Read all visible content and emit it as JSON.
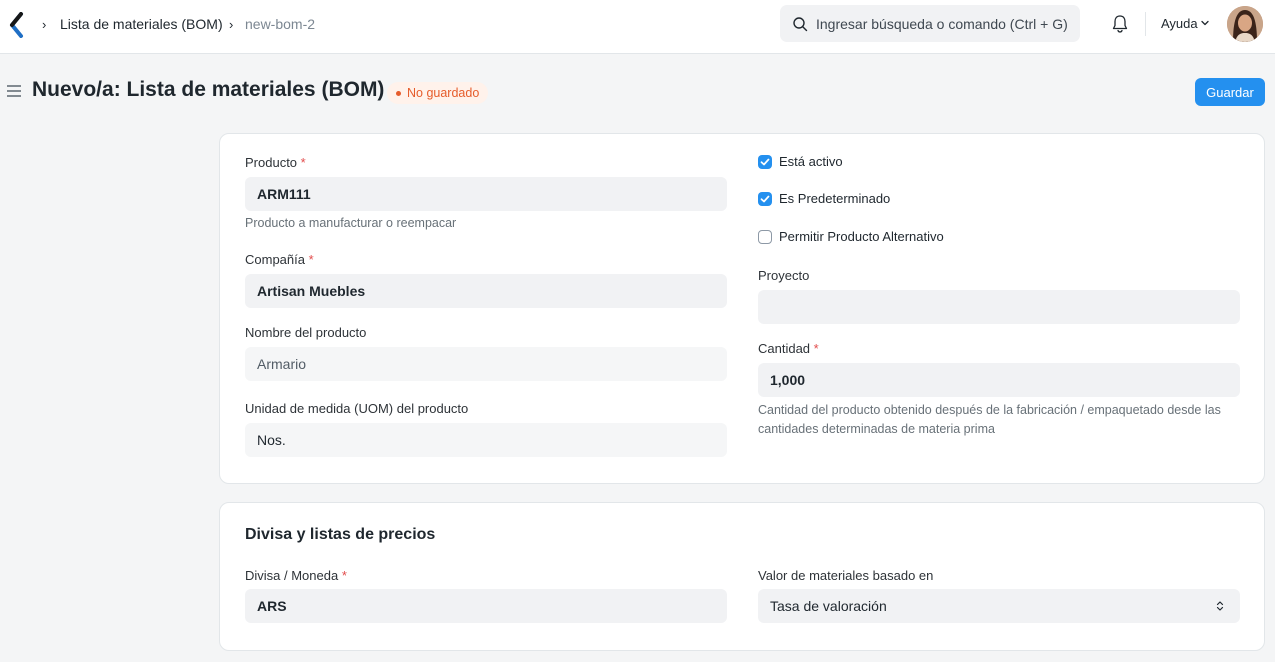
{
  "navbar": {
    "breadcrumbs": [
      "Lista de materiales (BOM)",
      "new-bom-2"
    ],
    "search_placeholder": "Ingresar búsqueda o comando (Ctrl + G)",
    "help_label": "Ayuda"
  },
  "header": {
    "title": "Nuevo/a: Lista de materiales (BOM)",
    "status": "No guardado",
    "save_label": "Guardar"
  },
  "form": {
    "producto": {
      "label": "Producto",
      "value": "ARM111",
      "help": "Producto a manufacturar o reempacar"
    },
    "compania": {
      "label": "Compañía",
      "value": "Artisan Muebles"
    },
    "nombre_producto": {
      "label": "Nombre del producto",
      "value": "Armario"
    },
    "uom": {
      "label": "Unidad de medida (UOM) del producto",
      "value": "Nos."
    },
    "esta_activo": {
      "label": "Está activo",
      "checked": true
    },
    "es_predeterminado": {
      "label": "Es Predeterminado",
      "checked": true
    },
    "permitir_alternativo": {
      "label": "Permitir Producto Alternativo",
      "checked": false
    },
    "proyecto": {
      "label": "Proyecto",
      "value": ""
    },
    "cantidad": {
      "label": "Cantidad",
      "value": "1,000",
      "help": "Cantidad del producto obtenido después de la fabricación / empaquetado desde las cantidades determinadas de materia prima"
    }
  },
  "section_currency": {
    "title": "Divisa y listas de precios",
    "divisa": {
      "label": "Divisa / Moneda",
      "value": "ARS"
    },
    "valor_materiales": {
      "label": "Valor de materiales basado en",
      "value": "Tasa de valoración"
    }
  },
  "colors": {
    "primary": "#2490ef",
    "unsaved": "#e65c2b",
    "required": "#e24c4c"
  }
}
